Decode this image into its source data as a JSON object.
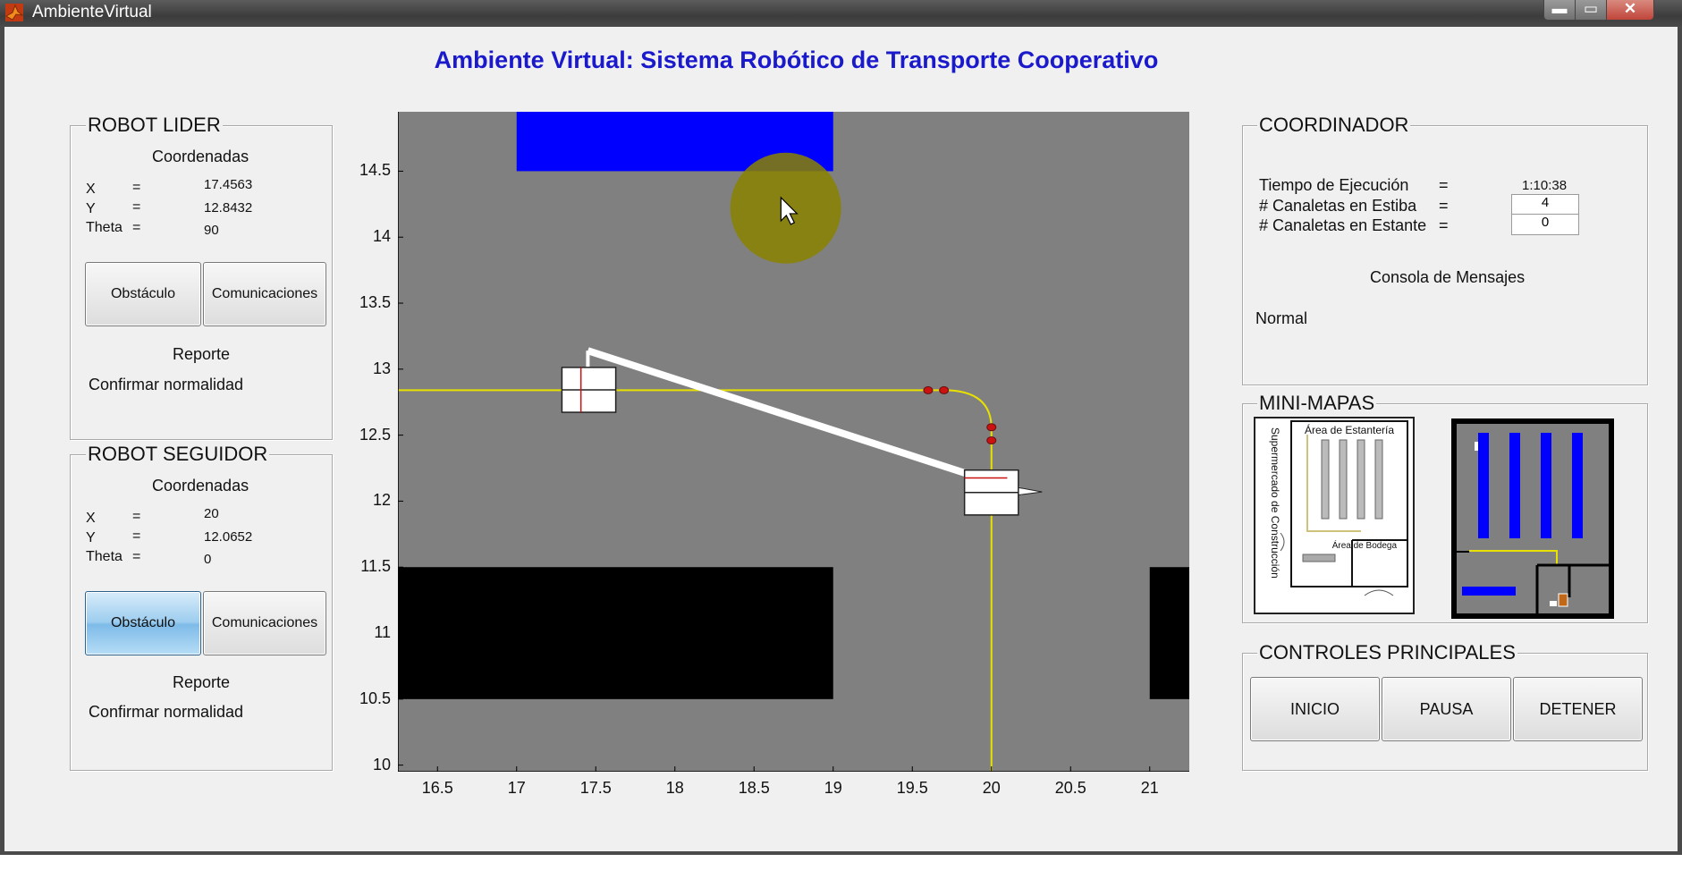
{
  "window": {
    "title": "AmbienteVirtual",
    "controls": {
      "minimize": "▬",
      "maximize": "▭",
      "close": "✕"
    }
  },
  "main_title": "Ambiente Virtual: Sistema Robótico de Transporte Cooperativo",
  "robot_lider": {
    "title": "ROBOT LIDER",
    "coords_label": "Coordenadas",
    "x_label": "X",
    "y_label": "Y",
    "theta_label": "Theta",
    "eq": "=",
    "x": "17.4563",
    "y": "12.8432",
    "theta": "90",
    "obstacle_button": "Obstáculo",
    "comm_button": "Comunicaciones",
    "report_label": "Reporte",
    "report_text": "Confirmar normalidad"
  },
  "robot_seguidor": {
    "title": "ROBOT SEGUIDOR",
    "coords_label": "Coordenadas",
    "x_label": "X",
    "y_label": "Y",
    "theta_label": "Theta",
    "eq": "=",
    "x": "20",
    "y": "12.0652",
    "theta": "0",
    "obstacle_button": "Obstáculo",
    "comm_button": "Comunicaciones",
    "report_label": "Reporte",
    "report_text": "Confirmar normalidad"
  },
  "coordinador": {
    "title": "COORDINADOR",
    "exec_time_label": "Tiempo de Ejecución",
    "exec_time": "1:10:38",
    "stack_label": "# Canaletas en Estiba",
    "stack_value": "4",
    "shelf_label": "# Canaletas en Estante",
    "shelf_value": "0",
    "eq": "=",
    "console_label": "Consola de Mensajes",
    "console_text": "Normal"
  },
  "mini_mapas": {
    "title": "MINI-MAPAS",
    "map1_area_shelves": "Área de Estantería",
    "map1_side": "Supermercado de Construcción",
    "map1_area_warehouse": "Área de Bodega"
  },
  "controles": {
    "title": "CONTROLES PRINCIPALES",
    "start": "INICIO",
    "pause": "PAUSA",
    "stop": "DETENER"
  },
  "plot": {
    "xlim": [
      16.25,
      21.25
    ],
    "ylim": [
      9.95,
      14.95
    ],
    "xticks": [
      "16.5",
      "17",
      "17.5",
      "18",
      "18.5",
      "19",
      "19.5",
      "20",
      "20.5",
      "21"
    ],
    "yticks": [
      "10",
      "10.5",
      "11",
      "11.5",
      "12",
      "12.5",
      "13",
      "13.5",
      "14",
      "14.5"
    ],
    "background": "#808080",
    "path_color": "#e8e000",
    "obstacle_color": "#000000",
    "target_color": "#0000ff",
    "cursor_highlight_color": "#8a8200"
  }
}
